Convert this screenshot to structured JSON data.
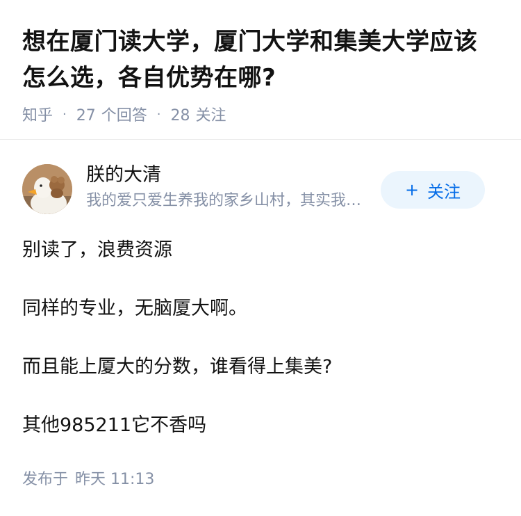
{
  "question": {
    "title_line1": "想在厦门读大学，厦门大学和集美大学应该",
    "title_line2": "怎么选，各自优势在哪?",
    "platform": "知乎",
    "answer_count": "27",
    "answer_label": "个回答",
    "follow_count": "28",
    "follow_label": "关注"
  },
  "author": {
    "name": "朕的大清",
    "bio": "我的爱只爱生养我的家乡山村，其实我的爱也很大，我的爱没边没沿",
    "avatar_icon": "duck-avatar-icon"
  },
  "follow_button": {
    "icon": "plus-icon",
    "plus": "+",
    "label": "关注",
    "bg_color": "#ebf5fd",
    "text_color": "#056de8"
  },
  "answer": {
    "paragraphs": [
      "别读了，浪费资源",
      "同样的专业，无脑厦大啊。",
      "而且能上厦大的分数，谁看得上集美?",
      "其他985211它不香吗"
    ]
  },
  "publish": {
    "label": "发布于",
    "time": "昨天 11:13"
  }
}
